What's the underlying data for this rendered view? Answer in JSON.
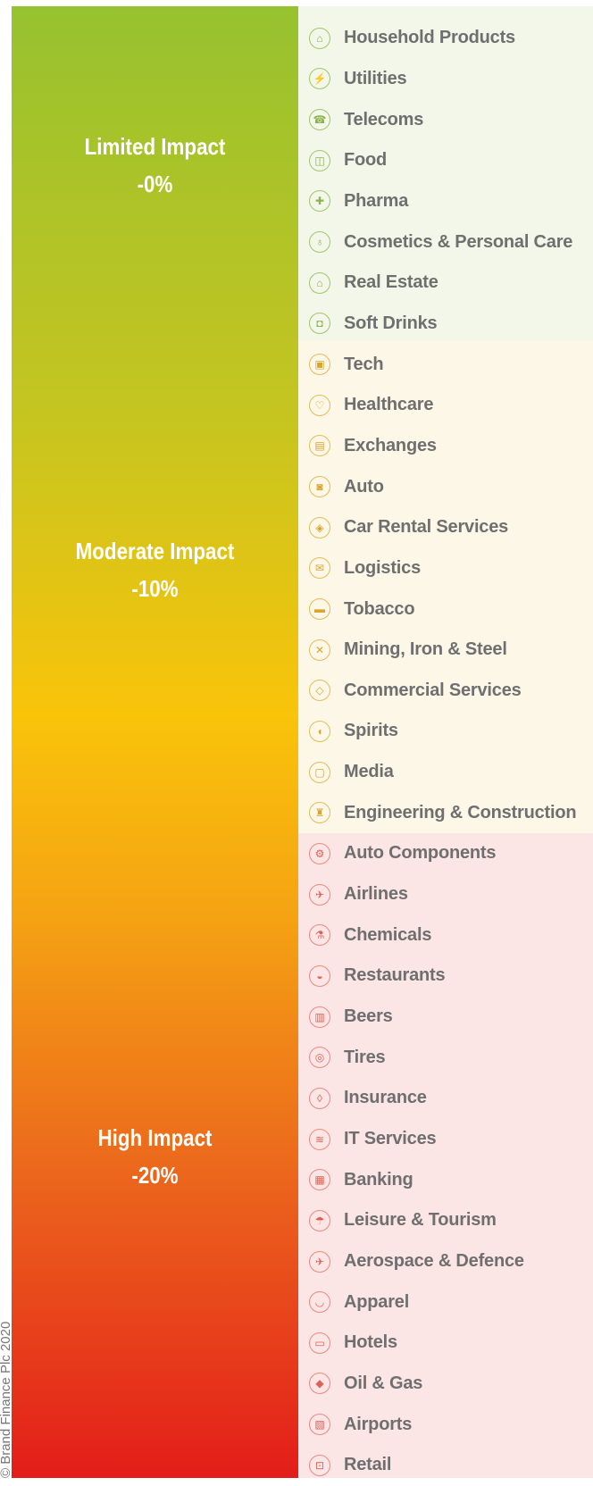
{
  "copyright": "© Brand Finance Plc 2020",
  "tiers": [
    {
      "title": "Limited Impact",
      "value": "-0%"
    },
    {
      "title": "Moderate Impact",
      "value": "-10%"
    },
    {
      "title": "High Impact",
      "value": "-20%"
    }
  ],
  "colors": {
    "gradient_top": "#97c22f",
    "gradient_mid": "#f9c40a",
    "gradient_bottom": "#e31d1a",
    "band_limited": "#f2f7e9",
    "band_moderate": "#fdf7e8",
    "band_high": "#fbe5e5",
    "label": "#6f6f6f"
  },
  "sectors": [
    {
      "label": "Household Products",
      "icon": "household-products-icon",
      "tier": "limited"
    },
    {
      "label": "Utilities",
      "icon": "utilities-icon",
      "tier": "limited"
    },
    {
      "label": "Telecoms",
      "icon": "telecoms-icon",
      "tier": "limited"
    },
    {
      "label": "Food",
      "icon": "food-icon",
      "tier": "limited"
    },
    {
      "label": "Pharma",
      "icon": "pharma-icon",
      "tier": "limited"
    },
    {
      "label": "Cosmetics & Personal Care",
      "icon": "cosmetics-icon",
      "tier": "limited"
    },
    {
      "label": "Real Estate",
      "icon": "real-estate-icon",
      "tier": "limited"
    },
    {
      "label": "Soft Drinks",
      "icon": "soft-drinks-icon",
      "tier": "limited"
    },
    {
      "label": "Tech",
      "icon": "tech-icon",
      "tier": "moderate"
    },
    {
      "label": "Healthcare",
      "icon": "healthcare-icon",
      "tier": "moderate"
    },
    {
      "label": "Exchanges",
      "icon": "exchanges-icon",
      "tier": "moderate"
    },
    {
      "label": "Auto",
      "icon": "auto-icon",
      "tier": "moderate"
    },
    {
      "label": "Car Rental Services",
      "icon": "car-rental-icon",
      "tier": "moderate"
    },
    {
      "label": "Logistics",
      "icon": "logistics-icon",
      "tier": "moderate"
    },
    {
      "label": "Tobacco",
      "icon": "tobacco-icon",
      "tier": "moderate"
    },
    {
      "label": "Mining, Iron & Steel",
      "icon": "mining-icon",
      "tier": "moderate"
    },
    {
      "label": "Commercial Services",
      "icon": "commercial-services-icon",
      "tier": "moderate"
    },
    {
      "label": "Spirits",
      "icon": "spirits-icon",
      "tier": "moderate"
    },
    {
      "label": "Media",
      "icon": "media-icon",
      "tier": "moderate"
    },
    {
      "label": "Engineering & Construction",
      "icon": "engineering-icon",
      "tier": "moderate"
    },
    {
      "label": "Auto Components",
      "icon": "auto-components-icon",
      "tier": "high"
    },
    {
      "label": "Airlines",
      "icon": "airlines-icon",
      "tier": "high"
    },
    {
      "label": "Chemicals",
      "icon": "chemicals-icon",
      "tier": "high"
    },
    {
      "label": "Restaurants",
      "icon": "restaurants-icon",
      "tier": "high"
    },
    {
      "label": "Beers",
      "icon": "beers-icon",
      "tier": "high"
    },
    {
      "label": "Tires",
      "icon": "tires-icon",
      "tier": "high"
    },
    {
      "label": "Insurance",
      "icon": "insurance-icon",
      "tier": "high"
    },
    {
      "label": "IT Services",
      "icon": "it-services-icon",
      "tier": "high"
    },
    {
      "label": "Banking",
      "icon": "banking-icon",
      "tier": "high"
    },
    {
      "label": "Leisure & Tourism",
      "icon": "leisure-icon",
      "tier": "high"
    },
    {
      "label": "Aerospace & Defence",
      "icon": "aerospace-icon",
      "tier": "high"
    },
    {
      "label": "Apparel",
      "icon": "apparel-icon",
      "tier": "high"
    },
    {
      "label": "Hotels",
      "icon": "hotels-icon",
      "tier": "high"
    },
    {
      "label": "Oil & Gas",
      "icon": "oil-gas-icon",
      "tier": "high"
    },
    {
      "label": "Airports",
      "icon": "airports-icon",
      "tier": "high"
    },
    {
      "label": "Retail",
      "icon": "retail-icon",
      "tier": "high"
    }
  ]
}
